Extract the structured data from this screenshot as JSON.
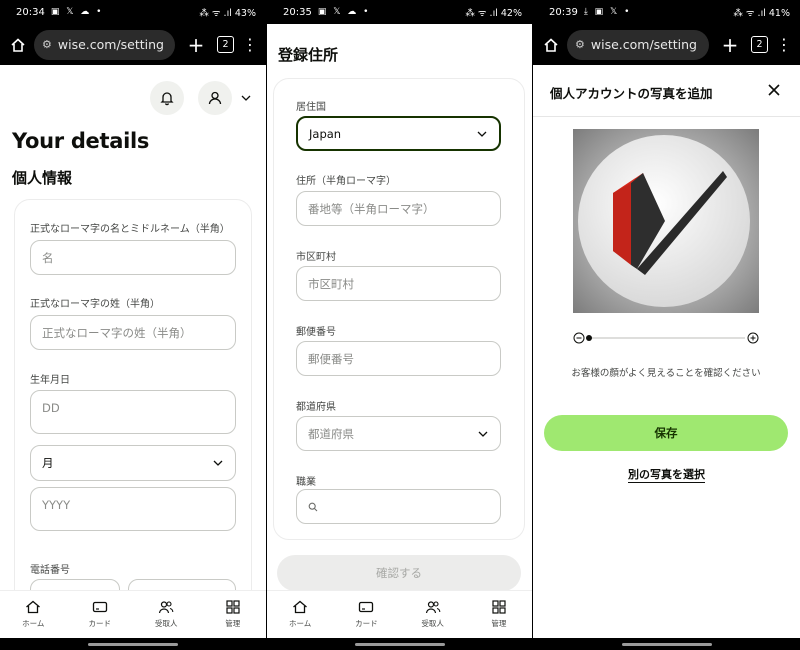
{
  "status_bars": [
    {
      "time": "20:34",
      "icons": "▣ 𝕏 ☁ •",
      "right": "⁂ ᯤ .ıl 43%"
    },
    {
      "time": "20:35",
      "icons": "▣ 𝕏 ☁ •",
      "right": "⁂ ᯤ .ıl 42%"
    },
    {
      "time": "20:39",
      "icons": "⤓ ▣ 𝕏 •",
      "right": "⁂ ᯤ .ıl 41%"
    }
  ],
  "browser": {
    "url": "wise.com/setting",
    "tab_count": "2"
  },
  "panel1": {
    "title": "Your details",
    "section": "個人情報",
    "fields": {
      "first_name_label": "正式なローマ字の名とミドルネーム（半角）",
      "first_name_placeholder": "名",
      "last_name_label": "正式なローマ字の姓（半角）",
      "last_name_placeholder": "正式なローマ字の姓（半角）",
      "dob_label": "生年月日",
      "day_placeholder": "DD",
      "month_value": "月",
      "year_placeholder": "YYYY",
      "phone_label": "電話番号"
    }
  },
  "panel2": {
    "title": "登録住所",
    "fields": {
      "country_label": "居住国",
      "country_value": "Japan",
      "address_label": "住所（半角ローマ字）",
      "address_placeholder": "番地等（半角ローマ字）",
      "city_label": "市区町村",
      "city_placeholder": "市区町村",
      "postal_label": "郵便番号",
      "postal_placeholder": "郵便番号",
      "prefecture_label": "都道府県",
      "prefecture_value": "都道府県",
      "occupation_label": "職業"
    },
    "confirm_label": "確認する"
  },
  "panel3": {
    "title": "個人アカウントの写真を追加",
    "hint": "お客様の顔がよく見えることを確認ください",
    "save_label": "保存",
    "alt_label": "別の写真を選択",
    "zoom_level": 0
  },
  "bottom_nav": [
    "ホーム",
    "カード",
    "受取人",
    "管理"
  ],
  "colors": {
    "accent_green": "#9fe870",
    "dark_green": "#163300",
    "logo_red": "#d9291c"
  }
}
